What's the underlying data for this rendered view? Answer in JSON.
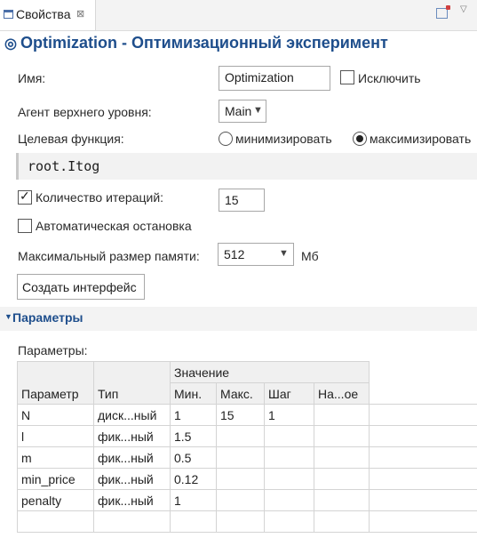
{
  "tab": {
    "title": "Свойства",
    "close": "⊠"
  },
  "header": {
    "title": "Optimization - Оптимизационный эксперимент"
  },
  "form": {
    "name_label": "Имя:",
    "name_value": "Optimization",
    "exclude_label": "Исключить",
    "exclude_checked": false,
    "top_agent_label": "Агент верхнего уровня:",
    "top_agent_value": "Main",
    "objective_label": "Целевая функция:",
    "minimize_label": "минимизировать",
    "maximize_label": "максимизировать",
    "objective_selected": "максимизировать",
    "objective_expr": "root.Itog",
    "iterations_label": "Количество итераций:",
    "iterations_checked": true,
    "iterations_value": "15",
    "autostop_label": "Автоматическая остановка",
    "autostop_checked": false,
    "memory_label": "Максимальный размер памяти:",
    "memory_value": "512",
    "memory_unit": "Мб",
    "create_ui_button": "Создать интерфейс"
  },
  "params_section": {
    "title": "Параметры",
    "sublabel": "Параметры:",
    "columns": {
      "param": "Параметр",
      "type": "Тип",
      "value_group": "Значение",
      "min": "Мин.",
      "max": "Макс.",
      "step": "Шаг",
      "suggested": "На...ое"
    },
    "rows": [
      {
        "param": "N",
        "type": "диск...ный",
        "min": "1",
        "max": "15",
        "step": "1",
        "suggested": ""
      },
      {
        "param": "l",
        "type": "фик...ный",
        "min": "1.5",
        "max": "",
        "step": "",
        "suggested": ""
      },
      {
        "param": "m",
        "type": "фик...ный",
        "min": "0.5",
        "max": "",
        "step": "",
        "suggested": ""
      },
      {
        "param": "min_price",
        "type": "фик...ный",
        "min": "0.12",
        "max": "",
        "step": "",
        "suggested": ""
      },
      {
        "param": "penalty",
        "type": "фик...ный",
        "min": "1",
        "max": "",
        "step": "",
        "suggested": ""
      }
    ]
  },
  "colors": {
    "accent": "#1e4e8c",
    "section_bg": "#f3f3f3"
  },
  "icons": [
    "properties-view-icon",
    "close-icon",
    "new-window-icon",
    "view-menu-icon",
    "experiment-icon",
    "chevron-down-icon",
    "collapse-arrow-icon"
  ]
}
